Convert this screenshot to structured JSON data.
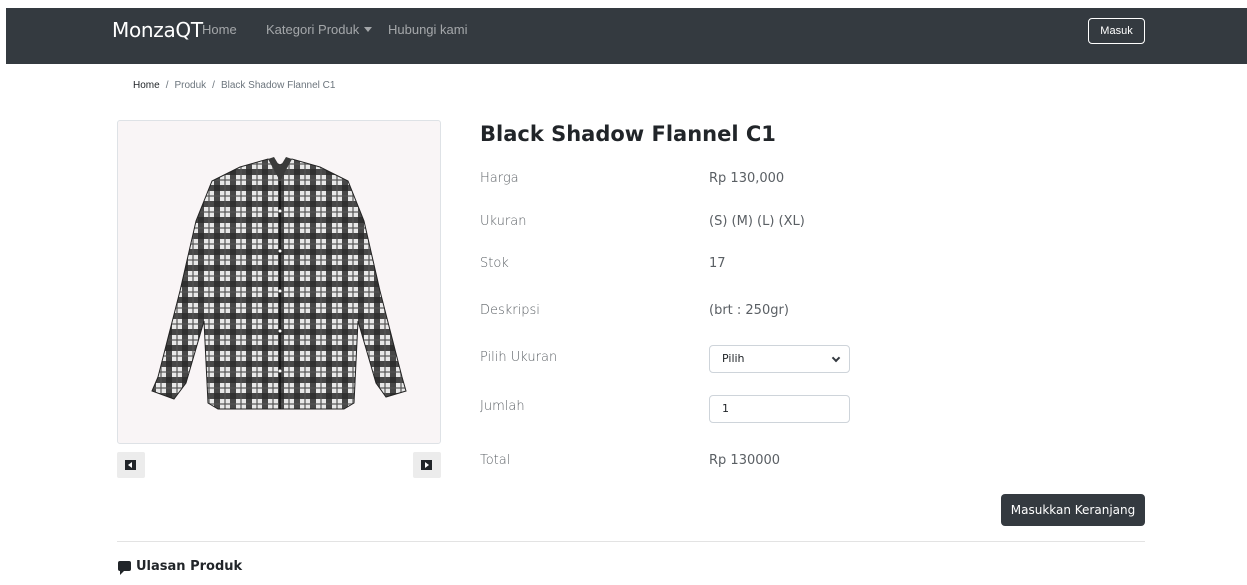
{
  "navbar": {
    "brand": "MonzaQT",
    "links": [
      "Home",
      "Kategori Produk",
      "Hubungi kami"
    ],
    "login_label": "Masuk"
  },
  "breadcrumb": [
    "Home",
    "Produk",
    "Black Shadow Flannel C1"
  ],
  "product": {
    "title": "Black Shadow Flannel C1",
    "fields": [
      {
        "label": "Harga",
        "value": "Rp 130,000"
      },
      {
        "label": "Ukuran",
        "value": "(S) (M) (L) (XL)"
      },
      {
        "label": "Stok",
        "value": "17"
      },
      {
        "label": "Deskripsi",
        "value": "(brt : 250gr)"
      }
    ],
    "size_select": {
      "label": "Pilih Ukuran",
      "selected": "Pilih"
    },
    "quantity": {
      "label": "Jumlah",
      "value": "1"
    },
    "total": {
      "label": "Total",
      "value": "Rp 130000"
    },
    "add_to_cart_label": "Masukkan Keranjang"
  },
  "reviews": {
    "heading": "Ulasan Produk"
  },
  "colors": {
    "navbar": "#343a40",
    "button_dark": "#343a40",
    "photo_bg": "#f9f5f6"
  }
}
